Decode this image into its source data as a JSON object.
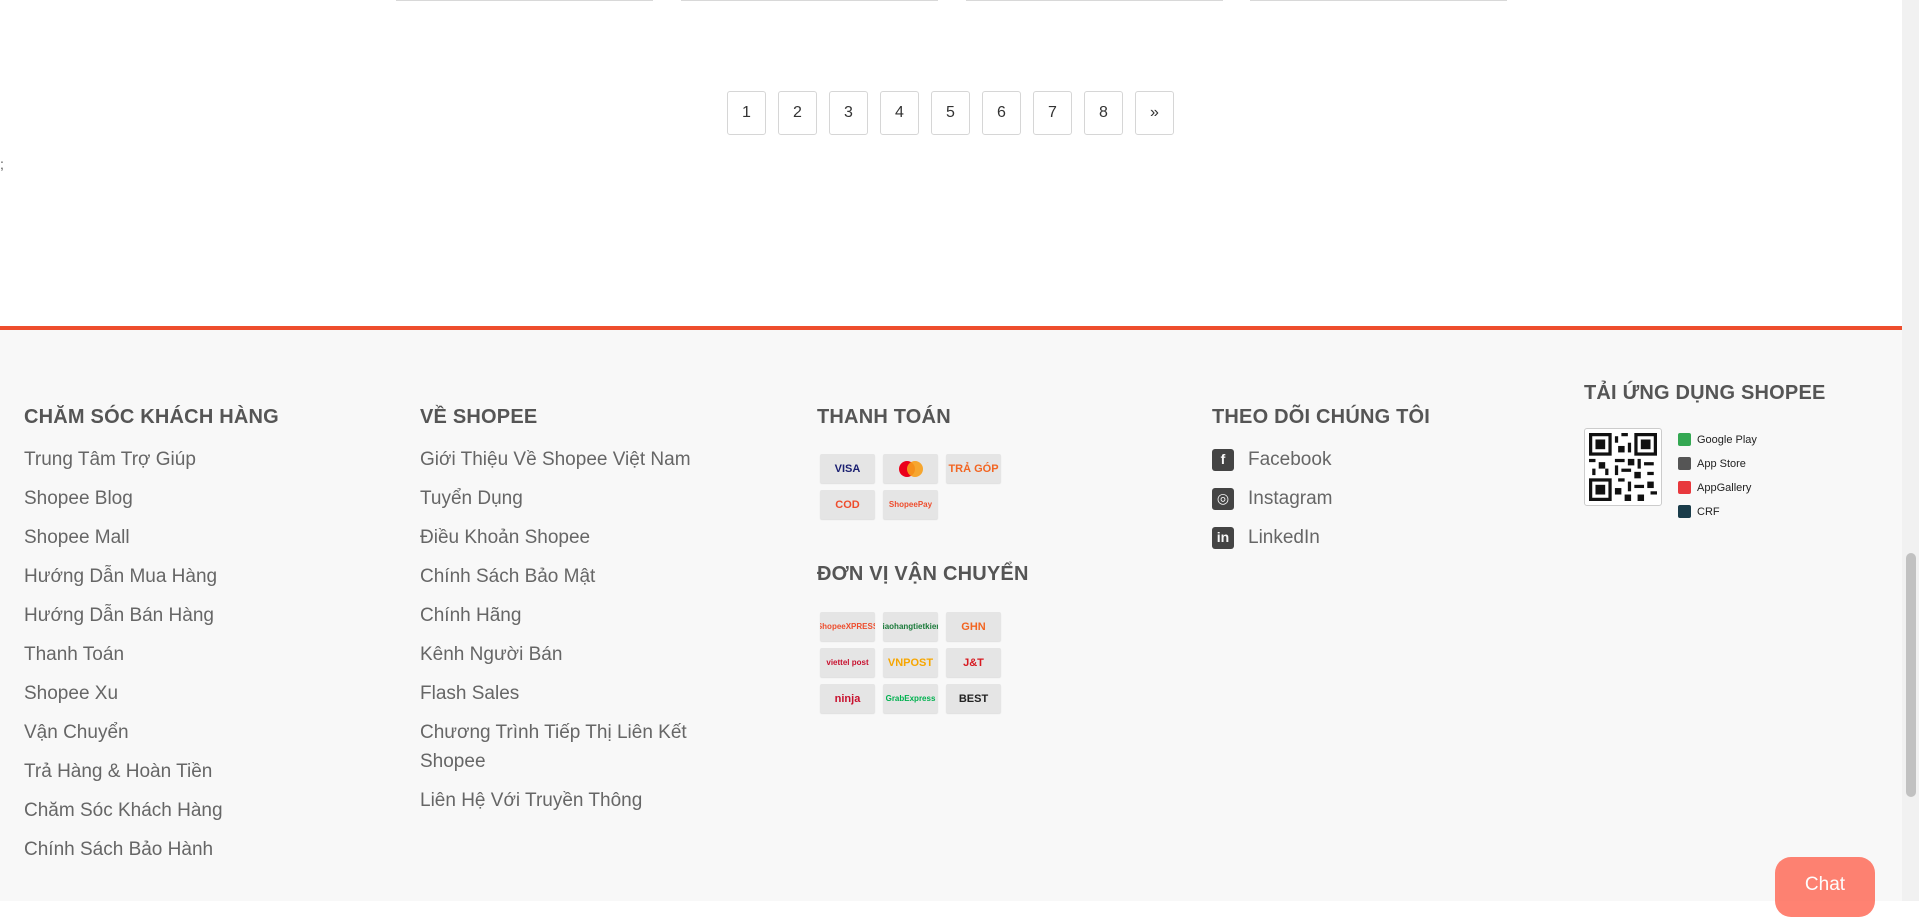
{
  "pagination": {
    "pages": [
      "1",
      "2",
      "3",
      "4",
      "5",
      "6",
      "7",
      "8"
    ],
    "next": "»"
  },
  "stray_text": ";",
  "footer": {
    "customer_care": {
      "title": "CHĂM SÓC KHÁCH HÀNG",
      "links": [
        "Trung Tâm Trợ Giúp",
        "Shopee Blog",
        "Shopee Mall",
        "Hướng Dẫn Mua Hàng",
        "Hướng Dẫn Bán Hàng",
        "Thanh Toán",
        "Shopee Xu",
        "Vận Chuyển",
        "Trả Hàng & Hoàn Tiền",
        "Chăm Sóc Khách Hàng",
        "Chính Sách Bảo Hành"
      ]
    },
    "about": {
      "title": "VỀ SHOPEE",
      "links": [
        "Giới Thiệu Về Shopee Việt Nam",
        "Tuyển Dụng",
        "Điều Khoản Shopee",
        "Chính Sách Bảo Mật",
        "Chính Hãng",
        "Kênh Người Bán",
        "Flash Sales",
        "Chương Trình Tiếp Thị Liên Kết Shopee",
        "Liên Hệ Với Truyền Thông"
      ]
    },
    "payment": {
      "title": "THANH TOÁN",
      "logos": [
        {
          "name": "visa-logo",
          "text": "VISA",
          "color": "#1a1f71"
        },
        {
          "name": "mastercard-logo",
          "text": "",
          "color": "#eb001b"
        },
        {
          "name": "tra-gop-logo",
          "text": "TRẢ GÓP",
          "color": "#f26522"
        },
        {
          "name": "cod-logo",
          "text": "COD",
          "color": "#ee4d2d"
        },
        {
          "name": "shopeepay-logo",
          "text": "ShopeePay",
          "color": "#ee4d2d"
        }
      ]
    },
    "shipping": {
      "title": "ĐƠN VỊ VẬN CHUYỂN",
      "logos": [
        {
          "name": "shopee-xpress-logo",
          "text": "ShopeeXPRESS",
          "color": "#ee4d2d"
        },
        {
          "name": "giao-hang-tiet-kiem-logo",
          "text": "giaohangtietkiem",
          "color": "#1b7a3a"
        },
        {
          "name": "ghn-logo",
          "text": "GHN",
          "color": "#f26522"
        },
        {
          "name": "viettel-post-logo",
          "text": "viettel post",
          "color": "#c8102e"
        },
        {
          "name": "vietnam-post-logo",
          "text": "VNPOST",
          "color": "#f7a600"
        },
        {
          "name": "jt-express-logo",
          "text": "J&T",
          "color": "#d71920"
        },
        {
          "name": "ninja-van-logo",
          "text": "ninja",
          "color": "#c8102e"
        },
        {
          "name": "grab-express-logo",
          "text": "GrabExpress",
          "color": "#00b14f"
        },
        {
          "name": "best-express-logo",
          "text": "BEST",
          "color": "#222222"
        }
      ]
    },
    "follow": {
      "title": "THEO DÕI CHÚNG TÔI",
      "links": [
        {
          "label": "Facebook",
          "icon": "facebook-icon",
          "glyph": "f"
        },
        {
          "label": "Instagram",
          "icon": "instagram-icon",
          "glyph": "◎"
        },
        {
          "label": "LinkedIn",
          "icon": "linkedin-icon",
          "glyph": "in"
        }
      ]
    },
    "app": {
      "title": "TẢI ỨNG DỤNG SHOPEE",
      "stores": [
        {
          "label": "Google Play",
          "icon": "google-play-icon",
          "color": "#34a853"
        },
        {
          "label": "App Store",
          "icon": "apple-icon",
          "color": "#555555"
        },
        {
          "label": "AppGallery",
          "icon": "appgallery-icon",
          "color": "#e8383d"
        },
        {
          "label": "CRF",
          "icon": "crf-icon",
          "color": "#1a3c4a"
        }
      ]
    }
  },
  "chat": {
    "label": "Chat"
  },
  "colors": {
    "accent": "#ee4d2d",
    "footer_bg": "#f8f8f8"
  }
}
